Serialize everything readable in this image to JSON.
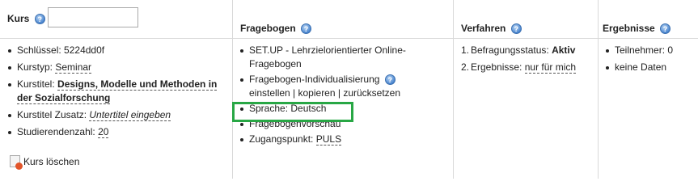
{
  "kurs": {
    "title": "Kurs",
    "search_value": "",
    "items": [
      {
        "label": "Schlüssel:",
        "value": "5224dd0f"
      },
      {
        "label": "Kurstyp:",
        "value": "Seminar"
      },
      {
        "label": "Kurstitel:",
        "value": "Designs, Modelle und Methoden in der Sozialforschung"
      },
      {
        "label": "Kurstitel Zusatz:",
        "value": "Untertitel eingeben"
      },
      {
        "label": "Studierendenzahl:",
        "value": "20"
      }
    ],
    "delete_label": "Kurs löschen"
  },
  "fragebogen": {
    "title": "Fragebogen",
    "items": [
      {
        "text": "SET.UP - Lehrzielorientierter Online-Fragebogen"
      },
      {
        "text": "Fragebogen-Individualisierung",
        "actions": [
          "einstellen",
          "kopieren",
          "zurücksetzen"
        ]
      },
      {
        "label": "Sprache:",
        "value": "Deutsch"
      },
      {
        "text": "Fragebogenvorschau"
      },
      {
        "label": "Zugangspunkt:",
        "value": "PULS"
      }
    ]
  },
  "verfahren": {
    "title": "Verfahren",
    "items": [
      {
        "num": "1.",
        "label": "Befragungsstatus:",
        "value": "Aktiv"
      },
      {
        "num": "2.",
        "label": "Ergebnisse:",
        "value": "nur für mich"
      }
    ]
  },
  "ergebnisse": {
    "title": "Ergebnisse",
    "items": [
      {
        "text": "Teilnehmer: 0"
      },
      {
        "text": "keine Daten"
      }
    ]
  },
  "help_glyph": "?",
  "accent_colors": {
    "highlight": "#28a745",
    "help": "#4b86cf"
  }
}
